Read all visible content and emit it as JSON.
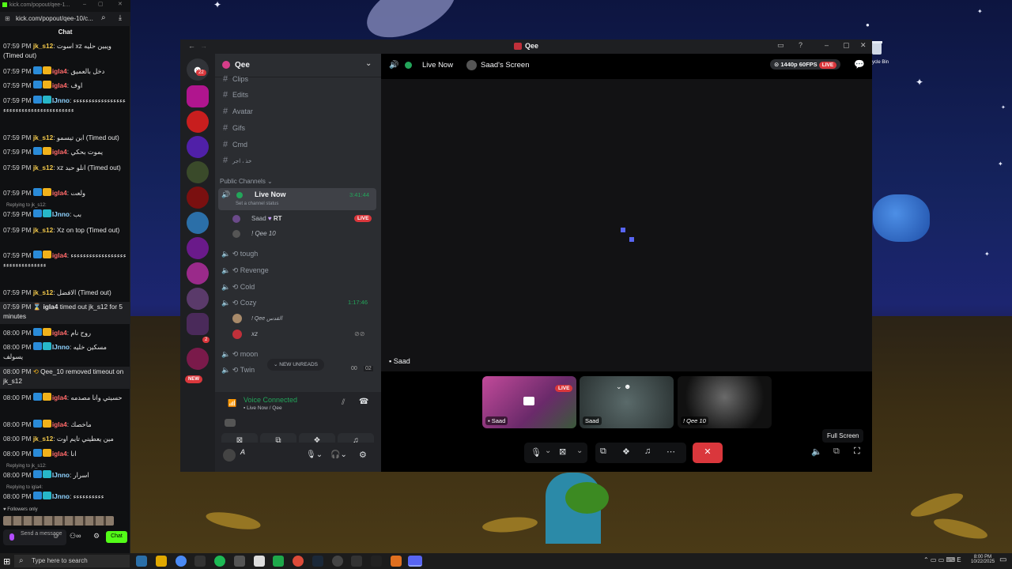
{
  "browser": {
    "url_title": "kick.com/popout/qee-1...",
    "url": "kick.com/popout/qee-10/c..."
  },
  "chat": {
    "title": "Chat",
    "messages": [
      {
        "time": "07:59 PM",
        "user": "jk_s12",
        "text": "اسوت xz ويبين حليه (Timed out)"
      },
      {
        "time": "07:59 PM",
        "user": "igla4",
        "text": "دخل بالعميق"
      },
      {
        "time": "07:59 PM",
        "user": "igla4",
        "text": "اوف"
      },
      {
        "time": "07:59 PM",
        "user": "IJnno",
        "text": "ءءءءءءءءءءءءءءءءءءءءءءءءءءءءءءءءءءءءءءءء"
      },
      {
        "time": "07:59 PM",
        "user": "jk_s12",
        "text": "ابن تيسمو (Timed out)"
      },
      {
        "time": "07:59 PM",
        "user": "igla4",
        "text": "يموت بحكي"
      },
      {
        "time": "07:59 PM",
        "user": "jk_s12",
        "text": "xz انلو حبد (Timed out)"
      },
      {
        "time": "07:59 PM",
        "user": "igla4",
        "text": "ولعت"
      },
      {
        "time": "07:59 PM",
        "user": "IJnno",
        "text": "بب"
      },
      {
        "time": "07:59 PM",
        "user": "jk_s12",
        "text": "Xz on top (Timed out)"
      },
      {
        "time": "07:59 PM",
        "user": "igla4",
        "text": "ءءءءءءءءءءءءءءءءءءءءءءءءءءءءءءءء"
      },
      {
        "time": "07:59 PM",
        "user": "jk_s12",
        "text": "الافضل (Timed out)"
      },
      {
        "time": "07:59 PM",
        "user": "igla4",
        "text": "timed out jk_s12 for 5 minutes"
      },
      {
        "time": "08:00 PM",
        "user": "igla4",
        "text": "روح نام"
      },
      {
        "time": "08:00 PM",
        "user": "IJnno",
        "text": "مسكين خليه يسولف"
      },
      {
        "time": "08:00 PM",
        "user": "Qee_10",
        "text": "removed timeout on jk_s12"
      },
      {
        "time": "08:00 PM",
        "user": "igla4",
        "text": "حسيتي وانا مصدمه"
      },
      {
        "time": "08:00 PM",
        "user": "igla4",
        "text": "ماخصك"
      },
      {
        "time": "08:00 PM",
        "user": "jk_s12",
        "text": "مين يعطيني تايم اوت"
      },
      {
        "time": "08:00 PM",
        "user": "igla4",
        "text": "انا"
      },
      {
        "time": "08:00 PM",
        "user": "IJnno",
        "text": "اسرار"
      },
      {
        "time": "08:00 PM",
        "user": "IJnno",
        "text": "ءءءءءءءءءء"
      }
    ],
    "reply_to_1": "Replying to jk_s12:",
    "reply_to_2": "Replying to jk_s12:",
    "reply_to_3": "Replying to igla4:",
    "followers_only": "Followers only",
    "input_placeholder": "Send a message",
    "send_label": "Chat"
  },
  "discord": {
    "title": "Qee",
    "server_name": "Qee",
    "notif_count": "22",
    "text_channels": [
      "Clips",
      "Edits",
      "Avatar",
      "Gifs",
      "Cmd",
      "خذ ، اجر"
    ],
    "public_channels_label": "Public Channels",
    "live_channel": {
      "name": "Live Now",
      "timer": "3:41:44",
      "status": "Set a channel status"
    },
    "live_users": [
      {
        "name": "Saad",
        "extra": "RT",
        "live": "LIVE"
      },
      {
        "name": "! Qee 10"
      }
    ],
    "voice_channels": [
      "tough",
      "Revenge",
      "Cold",
      "Cozy",
      "moon",
      "Twin"
    ],
    "cozy_timer": "1:17:46",
    "cozy_users": [
      "! Qee القدس",
      "xz"
    ],
    "new_unreads": "NEW UNREADS",
    "twin_counts": [
      "00",
      "02"
    ],
    "new_badge": "NEW",
    "badge2": "2",
    "voice_connected": "Voice Connected",
    "voice_sub": "Live Now / Qee",
    "me_name": "A",
    "header_channel": "Live Now",
    "header_screen": "Saad's Screen",
    "quality": "1440p 60FPS",
    "live_label": "LIVE",
    "stage_name": "Saad",
    "tiles": [
      {
        "label": "Saad",
        "live": "LIVE"
      },
      {
        "label": "Saad"
      },
      {
        "label": "! Qee 10"
      }
    ],
    "tooltip": "Full Screen"
  },
  "desktop": {
    "recycle_bin": "ycle Bin"
  },
  "taskbar": {
    "search_placeholder": "Type here to search",
    "time": "8:00 PM",
    "date": "10/22/2025"
  },
  "colors": {
    "kick_green": "#53fc18",
    "live_red": "#da373c",
    "discord_green": "#23a55a",
    "blurple": "#5865f2"
  }
}
